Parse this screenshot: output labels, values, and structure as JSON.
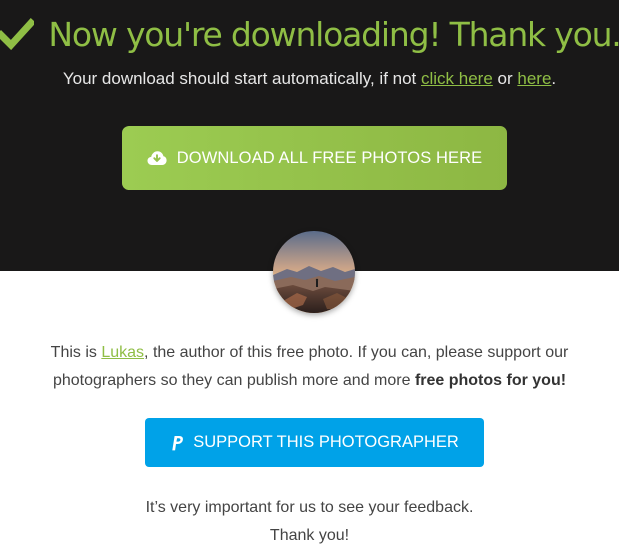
{
  "header": {
    "check_icon": "checkmark-icon",
    "title": "Now you're downloading! Thank you.",
    "subtitle_text": "Your download should start automatically, if not ",
    "click_here_link": "click here",
    "or_text": " or ",
    "here_link": "here",
    "period": "."
  },
  "download_button": {
    "icon": "cloud-download-icon",
    "label": "DOWNLOAD ALL FREE PHOTOS HERE"
  },
  "author": {
    "avatar_icon": "author-avatar",
    "intro": "This is ",
    "name": "Lukas",
    "text": ", the author of this free photo. If you can, please support our photographers so they can publish more and more ",
    "emphasis": "free photos for you!"
  },
  "support_button": {
    "icon": "paypal-icon",
    "label": "SUPPORT THIS PHOTOGRAPHER"
  },
  "feedback": {
    "line1": "It’s very important for us to see your feedback.",
    "line2": "Thank you!"
  },
  "colors": {
    "accent_green": "#8fbe45",
    "dark_background": "#191818",
    "support_blue": "#00a2e8"
  }
}
